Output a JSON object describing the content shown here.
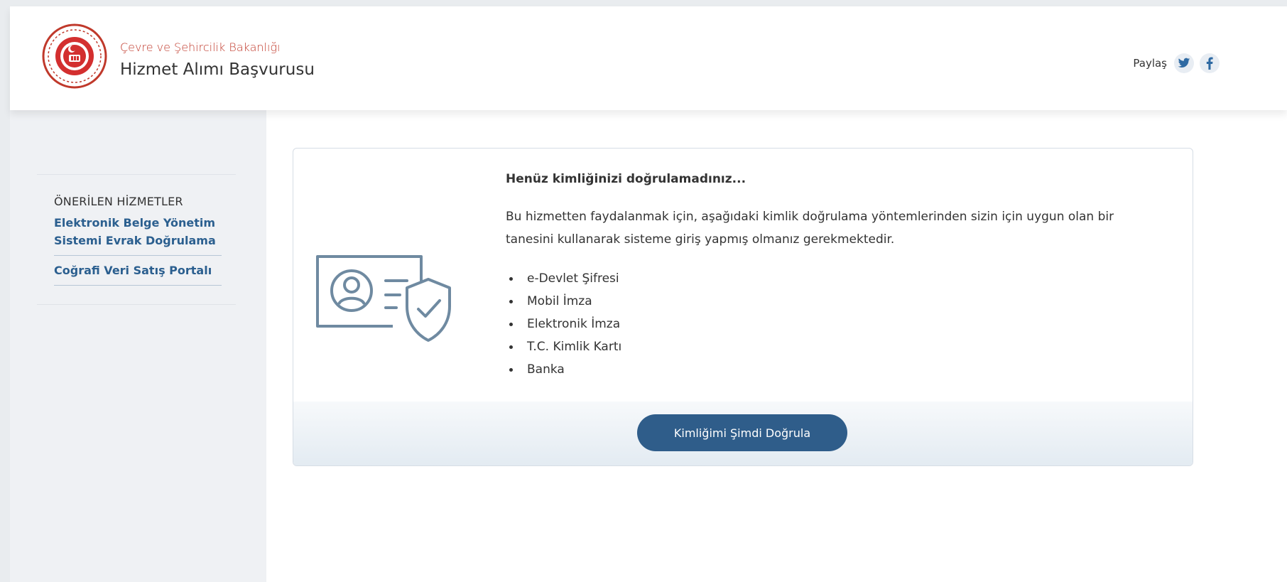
{
  "header": {
    "ministry": "Çevre ve Şehircilik Bakanlığı",
    "service_title": "Hizmet Alımı Başvurusu",
    "share_label": "Paylaş",
    "share_icons": [
      "twitter-icon",
      "facebook-icon"
    ]
  },
  "sidebar": {
    "title": "ÖNERİLEN HİZMETLER",
    "items": [
      {
        "label": "Elektronik Belge Yönetim Sistemi Evrak Doğrulama"
      },
      {
        "label": "Coğrafi Veri Satış Portalı"
      }
    ]
  },
  "main": {
    "title": "Henüz kimliğinizi doğrulamadınız...",
    "description": "Bu hizmetten faydalanmak için, aşağıdaki kimlik doğrulama yöntemlerinden sizin için uygun olan bir tanesini kullanarak sisteme giriş yapmış olmanız gerekmektedir.",
    "methods": [
      "e-Devlet Şifresi",
      "Mobil İmza",
      "Elektronik İmza",
      "T.C. Kimlik Kartı",
      "Banka"
    ],
    "button_label": "Kimliğimi Şimdi Doğrula"
  },
  "colors": {
    "link": "#2b5f8f",
    "button": "#2f5d8a",
    "ministry_text": "#c0392b",
    "sidebar_bg": "#eff1f4"
  }
}
